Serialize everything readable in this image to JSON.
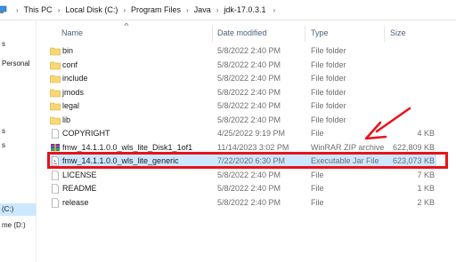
{
  "address_bar": {
    "crumbs": [
      "This PC",
      "Local Disk (C:)",
      "Program Files",
      "Java",
      "jdk-17.0.3.1"
    ]
  },
  "nav_pane": {
    "items": [
      "s",
      "Personal",
      "s",
      "s",
      "(C:)",
      "me (D:)"
    ],
    "selected": "(C:)"
  },
  "columns": {
    "name": "Name",
    "date": "Date modified",
    "type": "Type",
    "size": "Size"
  },
  "files": [
    {
      "name": "bin",
      "date": "5/8/2022 2:40 PM",
      "type": "File folder",
      "size": "",
      "icon": "folder-icon"
    },
    {
      "name": "conf",
      "date": "5/8/2022 2:40 PM",
      "type": "File folder",
      "size": "",
      "icon": "folder-icon"
    },
    {
      "name": "include",
      "date": "5/8/2022 2:40 PM",
      "type": "File folder",
      "size": "",
      "icon": "folder-icon"
    },
    {
      "name": "jmods",
      "date": "5/8/2022 2:40 PM",
      "type": "File folder",
      "size": "",
      "icon": "folder-icon"
    },
    {
      "name": "legal",
      "date": "5/8/2022 2:40 PM",
      "type": "File folder",
      "size": "",
      "icon": "folder-icon"
    },
    {
      "name": "lib",
      "date": "5/8/2022 2:40 PM",
      "type": "File folder",
      "size": "",
      "icon": "folder-icon"
    },
    {
      "name": "COPYRIGHT",
      "date": "4/25/2022 9:19 PM",
      "type": "File",
      "size": "4 KB",
      "icon": "file-icon"
    },
    {
      "name": "fmw_14.1.1.0.0_wls_lite_Disk1_1of1",
      "date": "11/14/2023 3:02 PM",
      "type": "WinRAR ZIP archive",
      "size": "622,809 KB",
      "icon": "winrar-zip-icon"
    },
    {
      "name": "fmw_14.1.1.0.0_wls_lite_generic",
      "date": "7/22/2020 6:30 PM",
      "type": "Executable Jar File",
      "size": "623,073 KB",
      "icon": "java-jar-icon",
      "selected": true
    },
    {
      "name": "LICENSE",
      "date": "5/8/2022 2:40 PM",
      "type": "File",
      "size": "7 KB",
      "icon": "file-icon"
    },
    {
      "name": "README",
      "date": "5/8/2022 2:40 PM",
      "type": "File",
      "size": "1 KB",
      "icon": "file-icon"
    },
    {
      "name": "release",
      "date": "5/8/2022 2:40 PM",
      "type": "File",
      "size": "2 KB",
      "icon": "file-icon"
    }
  ],
  "annotation": {
    "highlight_color": "#e8121b",
    "arrow_color": "#e8121b"
  }
}
